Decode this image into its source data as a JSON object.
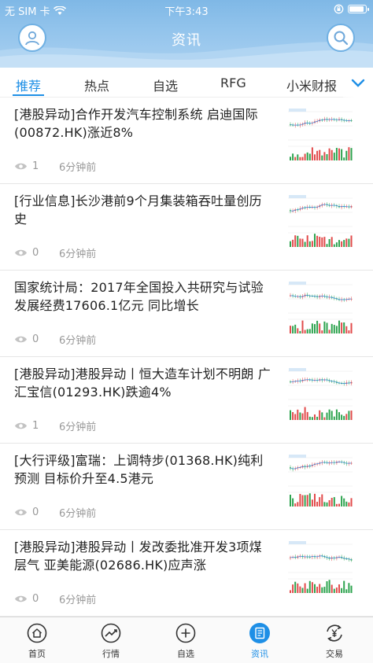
{
  "status_bar": {
    "carrier": "无 SIM 卡",
    "time": "下午3:43"
  },
  "header": {
    "title": "资讯",
    "accent_color": "#1e8fe6"
  },
  "tabs": [
    {
      "label": "推荐",
      "active": true
    },
    {
      "label": "热点",
      "active": false
    },
    {
      "label": "自选",
      "active": false
    },
    {
      "label": "RFG",
      "active": false
    },
    {
      "label": "小米财报",
      "active": false
    }
  ],
  "news": [
    {
      "title": "[港股异动]合作开发汽车控制系统 启迪国际(00872.HK)涨近8%",
      "views": "1",
      "time": "6分钟前"
    },
    {
      "title": "[行业信息]长沙港前9个月集装箱吞吐量创历史",
      "views": "0",
      "time": "6分钟前"
    },
    {
      "title": "国家统计局：2017年全国投入共研究与试验发展经费17606.1亿元  同比增长",
      "views": "0",
      "time": "6分钟前"
    },
    {
      "title": "[港股异动]港股异动丨恒大造车计划不明朗 广汇宝信(01293.HK)跌逾4%",
      "views": "1",
      "time": "6分钟前"
    },
    {
      "title": "[大行评级]富瑞：上调特步(01368.HK)纯利预测 目标价升至4.5港元",
      "views": "0",
      "time": "6分钟前"
    },
    {
      "title": "[港股异动]港股异动丨发改委批准开发3项煤层气 亚美能源(02686.HK)应声涨",
      "views": "0",
      "time": "6分钟前"
    }
  ],
  "bottom_nav": [
    {
      "label": "首页",
      "icon": "home-icon",
      "active": false
    },
    {
      "label": "行情",
      "icon": "market-trend-icon",
      "active": false
    },
    {
      "label": "自选",
      "icon": "add-circle-icon",
      "active": false
    },
    {
      "label": "资讯",
      "icon": "news-icon",
      "active": true
    },
    {
      "label": "交易",
      "icon": "trade-yen-icon",
      "active": false
    }
  ]
}
